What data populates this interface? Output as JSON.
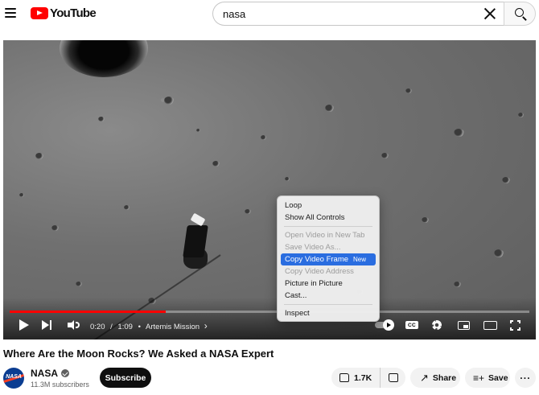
{
  "header": {
    "logo_text": "YouTube",
    "search": {
      "value": "nasa",
      "placeholder": "Search"
    }
  },
  "player": {
    "progress_fraction": 0.3,
    "time_current": "0:20",
    "time_separator": "/",
    "time_duration": "1:09",
    "chapter_bullet": "•",
    "chapter": "Artemis Mission",
    "chapter_chevron": "›",
    "cc_label": "CC"
  },
  "context_menu": {
    "items": [
      {
        "label": "Loop",
        "state": "normal"
      },
      {
        "label": "Show All Controls",
        "state": "normal"
      },
      {
        "label": "Open Video in New Tab",
        "state": "disabled"
      },
      {
        "label": "Save Video As...",
        "state": "disabled"
      },
      {
        "label": "Copy Video Frame",
        "badge": "New",
        "state": "highlight"
      },
      {
        "label": "Copy Video Address",
        "state": "disabled"
      },
      {
        "label": "Picture in Picture",
        "state": "normal"
      },
      {
        "label": "Cast...",
        "state": "normal"
      },
      {
        "label": "Inspect",
        "state": "normal"
      }
    ]
  },
  "video": {
    "title": "Where Are the Moon Rocks? We Asked a NASA Expert"
  },
  "channel": {
    "avatar_text": "NASA",
    "name": "NASA",
    "subscribers": "11.3M subscribers",
    "subscribe_label": "Subscribe"
  },
  "actions": {
    "like_count": "1.7K",
    "share_label": "Share",
    "share_glyph": "↗",
    "save_label": "Save",
    "save_glyph": "≡+",
    "more_glyph": "···"
  },
  "colors": {
    "brand_red": "#ff0000",
    "menu_highlight": "#2a6de0"
  }
}
